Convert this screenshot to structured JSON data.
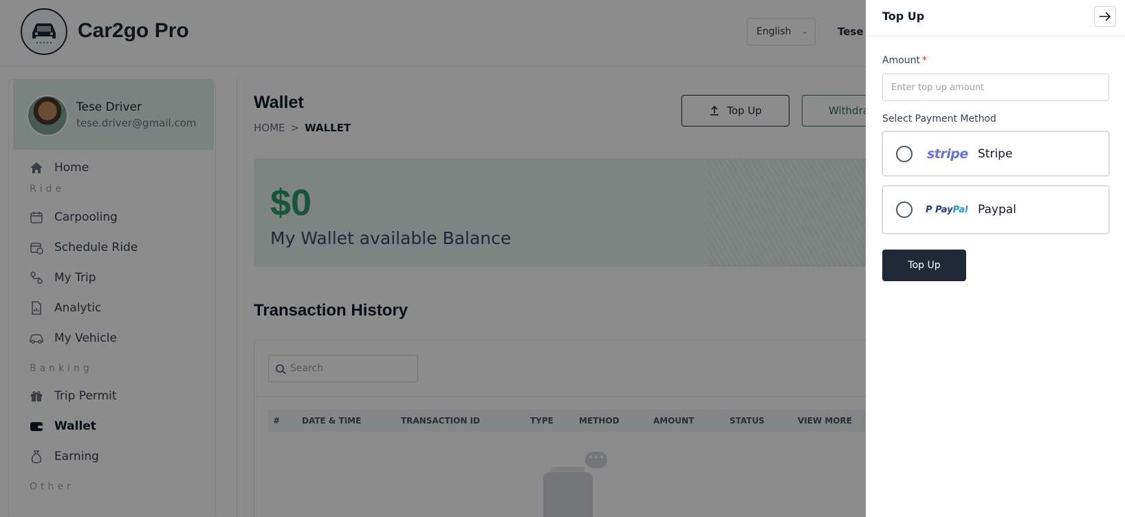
{
  "header": {
    "app_title": "Car2go Pro",
    "language": "English",
    "user_name": "Tese D"
  },
  "sidebar": {
    "profile": {
      "name": "Tese Driver",
      "email": "tese.driver@gmail.com"
    },
    "items": [
      {
        "label": "Home",
        "icon": "home-icon"
      },
      {
        "section": "Ride"
      },
      {
        "label": "Carpooling",
        "icon": "calendar-icon"
      },
      {
        "label": "Schedule Ride",
        "icon": "calendar-clock-icon"
      },
      {
        "label": "My Trip",
        "icon": "route-icon"
      },
      {
        "label": "Analytic",
        "icon": "report-icon"
      },
      {
        "label": "My Vehicle",
        "icon": "car-icon"
      },
      {
        "section": "Banking"
      },
      {
        "label": "Trip Permit",
        "icon": "gift-icon"
      },
      {
        "label": "Wallet",
        "icon": "wallet-icon",
        "active": true
      },
      {
        "label": "Earning",
        "icon": "money-bag-icon"
      },
      {
        "section": "Other"
      }
    ]
  },
  "main": {
    "title": "Wallet",
    "breadcrumb": {
      "home": "HOME",
      "separator": ">",
      "current": "WALLET"
    },
    "top_up_label": "Top Up",
    "withdraw_label": "Withdraw",
    "balance": {
      "amount": "$0",
      "label": "My Wallet available Balance"
    },
    "transaction_history": {
      "title": "Transaction History",
      "search_placeholder": "Search",
      "columns": [
        "#",
        "DATE & TIME",
        "TRANSACTION ID",
        "TYPE",
        "METHOD",
        "AMOUNT",
        "STATUS",
        "VIEW MORE"
      ]
    }
  },
  "drawer": {
    "title": "Top Up",
    "amount_label": "Amount",
    "required_mark": "*",
    "amount_placeholder": "Enter top up amount",
    "payment_method_label": "Select Payment Method",
    "methods": [
      {
        "logo": "stripe",
        "name": "Stripe"
      },
      {
        "logo_a": "Pay",
        "logo_b": "Pal",
        "name": "Paypal"
      }
    ],
    "submit_label": "Top Up"
  },
  "colors": {
    "accent_green": "#2e9a6f",
    "dark_button": "#1f2937",
    "balance_card_bg": "#e3f1ec",
    "stripe_purple": "#6772e5",
    "paypal_blue": "#253b80"
  }
}
